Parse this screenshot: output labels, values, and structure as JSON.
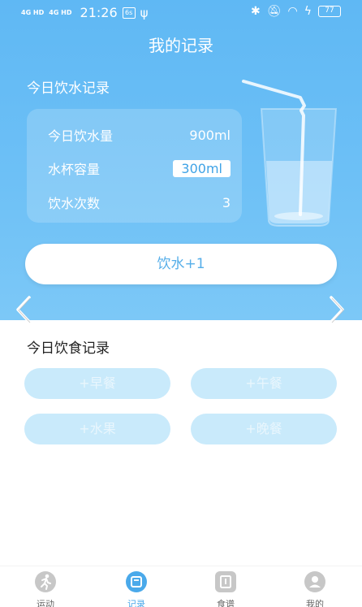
{
  "status_bar": {
    "signal1": "4G HD",
    "signal2": "4G HD",
    "time": "21:26",
    "notif_badge": "6s",
    "battery": "77"
  },
  "header": {
    "title": "我的记录"
  },
  "water": {
    "section_title": "今日饮水记录",
    "today_label": "今日饮水量",
    "today_value": "900ml",
    "cup_label": "水杯容量",
    "cup_value": "300ml",
    "count_label": "饮水次数",
    "count_value": "3",
    "add_button": "饮水+1"
  },
  "food": {
    "section_title": "今日饮食记录",
    "meals": [
      "+早餐",
      "+午餐",
      "+水果",
      "+晚餐"
    ]
  },
  "tabs": [
    {
      "label": "运动",
      "icon": "running-icon"
    },
    {
      "label": "记录",
      "icon": "record-icon"
    },
    {
      "label": "食谱",
      "icon": "recipe-icon"
    },
    {
      "label": "我的",
      "icon": "profile-icon"
    }
  ],
  "colors": {
    "accent": "#4aa9ea",
    "hero_top": "#5fb8f4",
    "meal_button": "#c9eafb"
  }
}
